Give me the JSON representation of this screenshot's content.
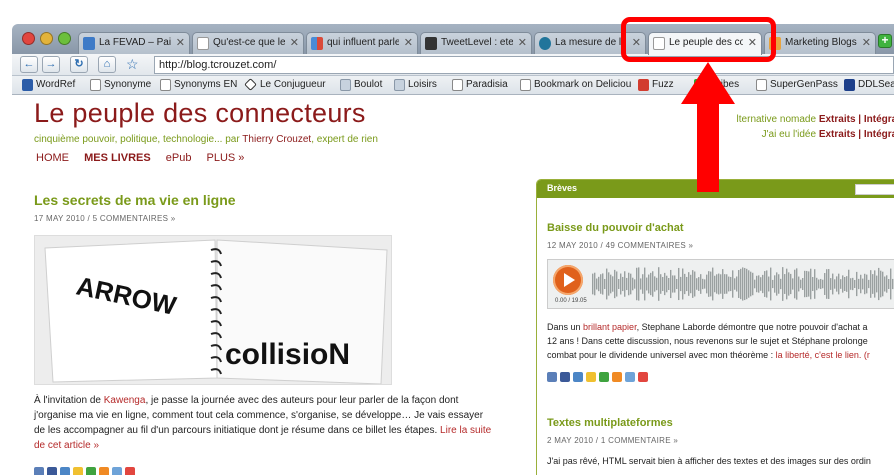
{
  "tabs": [
    {
      "label": "La FEVAD – Paiemen",
      "fav": "#3d7ac7"
    },
    {
      "label": "Qu'est-ce que le m",
      "fav": "#ffffff"
    },
    {
      "label": "qui influent parle d",
      "fav": "#4a8bd6"
    },
    {
      "label": "TweetLevel : etes-v",
      "fav": "#333333"
    },
    {
      "label": "La mesure de l'i",
      "fav": "#21759b"
    },
    {
      "label": "Le peuple des con",
      "fav": "#ffffff"
    },
    {
      "label": "Marketing Blogs –",
      "fav": "#e8a33d"
    }
  ],
  "toolbar": {
    "url": "http://blog.tcrouzet.com/"
  },
  "bookmarks": [
    {
      "label": "WordRef",
      "color": "#2b5ca8"
    },
    {
      "label": "Synonyme",
      "color": "#ffffff"
    },
    {
      "label": "Synonyms EN",
      "color": "#ffffff"
    },
    {
      "label": "Le Conjugueur",
      "color": "#3a3a3a"
    },
    {
      "label": "Boulot",
      "color": "#c7d2de"
    },
    {
      "label": "Loisirs",
      "color": "#c7d2de"
    },
    {
      "label": "Paradisia",
      "color": "#ffffff"
    },
    {
      "label": "Bookmark on Deliciou",
      "color": "#ffffff"
    },
    {
      "label": "Fuzz",
      "color": "#d23c2f"
    },
    {
      "label": "ytvibes",
      "color": "#2aa52a"
    },
    {
      "label": "SuperGenPass",
      "color": "#ffffff"
    },
    {
      "label": "DDLSearc",
      "color": "#1d3f8a"
    }
  ],
  "site": {
    "title": "Le peuple des connecteurs",
    "tagline_pre": "cinquième pouvoir, politique, technologie... par ",
    "tagline_author": "Thierry Crouzet",
    "tagline_post": ", expert de rien",
    "nav": [
      "HOME",
      "MES LIVRES",
      "ePub",
      "PLUS »"
    ],
    "topright1_pre": "lternative nomade ",
    "topright1_b": "Extraits | Intégral",
    "topright2_pre": "J'ai eu l'idée ",
    "topright2_b": "Extraits | Intégral"
  },
  "post": {
    "title": "Les secrets de ma vie en ligne",
    "meta": "17 MAY 2010 / 5 COMMENTAIRES »",
    "img_word1": "ARROW",
    "img_word2": "collisioN",
    "body_1": "À l'invitation de ",
    "body_link1": "Kawenga",
    "body_2": ", je passe la journée avec des auteurs pour leur parler de la façon dont j'organise ma vie en ligne, comment tout cela commence, s'organise, se développe… Je vais essayer de les accompagner au fil d'un parcours initiatique dont je résume dans ce billet les étapes. ",
    "body_link2": "Lire la suite de cet article »"
  },
  "sidebar": {
    "heading": "Brèves",
    "item1_title": "Baisse du pouvoir d'achat",
    "item1_meta": "12 MAY 2010 / 49 COMMENTAIRES »",
    "player_time": "0.00 / 19.05",
    "item1_l1_pre": "Dans un ",
    "item1_l1_link": "brillant papier",
    "item1_l1_post": ", Stephane Laborde démontre que notre pouvoir d'achat a",
    "item1_l2": "12 ans ! Dans cette discussion, nous revenons sur le sujet et Stéphane prolonge",
    "item1_l3_pre": "combat pour le dividende universel avec mon théorème : ",
    "item1_l3_link": "la liberté, c'est le lien. (r",
    "item2_title": "Textes multiplateformes",
    "item2_meta": "2 MAY 2010 / 1 COMMENTAIRE »",
    "item2_l1": "J'ai pas rêvé, HTML servait bien à afficher des textes et des images sur des ordin"
  },
  "colors": {
    "brand_red": "#8b1a1a",
    "brand_green": "#7a9a1a",
    "highlight": "#ff0000"
  }
}
